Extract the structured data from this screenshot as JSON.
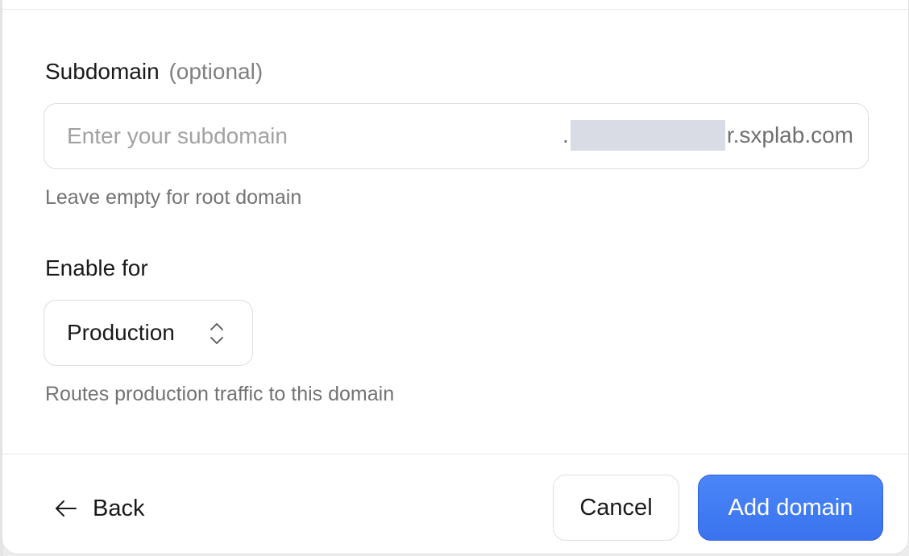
{
  "subdomain": {
    "label": "Subdomain",
    "optional_label": "(optional)",
    "placeholder": "Enter your subdomain",
    "value": "",
    "suffix_dot": ".",
    "suffix_domain": "r.sxplab.com",
    "help": "Leave empty for root domain"
  },
  "enable_for": {
    "label": "Enable for",
    "selected": "Production",
    "help": "Routes production traffic to this domain",
    "icon": "chevron-up-down-icon"
  },
  "footer": {
    "back_label": "Back",
    "back_icon": "arrow-left-icon",
    "cancel_label": "Cancel",
    "add_label": "Add domain"
  },
  "colors": {
    "primary": "#3a73ee",
    "primary_border": "#2e5fd8",
    "redaction": "#d9dce4"
  }
}
